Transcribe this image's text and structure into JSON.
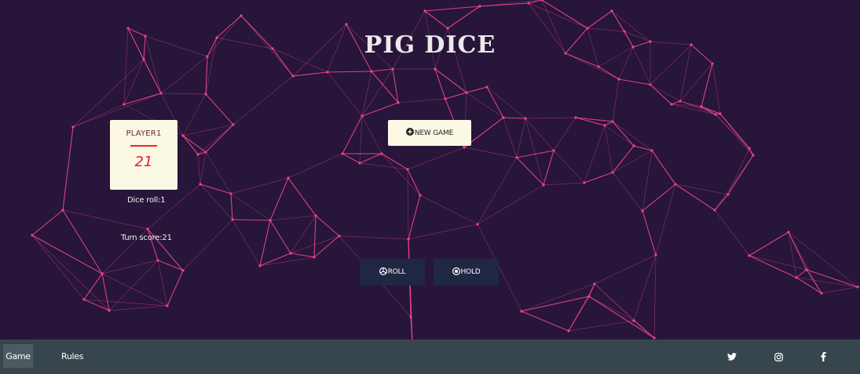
{
  "game": {
    "title": "PIG DICE",
    "new_game_label": "NEW GAME",
    "roll_label": "ROLL",
    "hold_label": "HOLD"
  },
  "player": {
    "name": "PLAYER1",
    "score": "21",
    "dice_roll": "Dice roll:1",
    "turn_score": "Turn score:21"
  },
  "nav": {
    "game_label": "Game",
    "rules_label": "Rules",
    "active": "Game",
    "social_icons": [
      "twitter-icon",
      "instagram-icon",
      "facebook-icon"
    ]
  },
  "colors": {
    "background": "#27153a",
    "network_lines": "#f0468c",
    "card": "#fbf8e4",
    "score": "#e0202a",
    "dark_button": "#1f2743",
    "navbar": "#37464c"
  }
}
